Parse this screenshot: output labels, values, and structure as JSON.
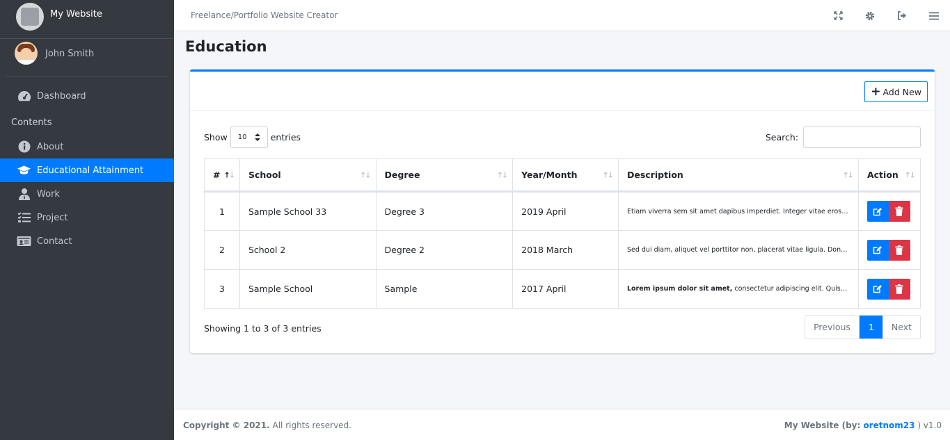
{
  "brand": {
    "name": "My Website"
  },
  "user": {
    "name": "John Smith"
  },
  "sidebar": {
    "dashboard": "Dashboard",
    "header": "Contents",
    "items": [
      {
        "label": "About",
        "icon": "info-circle-icon"
      },
      {
        "label": "Educational Attainment",
        "icon": "graduation-cap-icon",
        "active": true
      },
      {
        "label": "Work",
        "icon": "user-tie-icon"
      },
      {
        "label": "Project",
        "icon": "tasks-icon"
      },
      {
        "label": "Contact",
        "icon": "id-card-icon"
      }
    ]
  },
  "topbar": {
    "title": "Freelance/Portfolio Website Creator"
  },
  "page": {
    "title": "Education"
  },
  "card": {
    "add_label": "Add New"
  },
  "table_controls": {
    "show_label": "Show",
    "entries_label": "entries",
    "page_length": "10",
    "search_label": "Search:"
  },
  "table": {
    "headers": [
      "#",
      "School",
      "Degree",
      "Year/Month",
      "Description",
      "Action"
    ],
    "rows": [
      {
        "num": "1",
        "school": "Sample School 33",
        "degree": "Degree 3",
        "year": "2019 April",
        "desc_bold": "",
        "desc": "Etiam viverra sem sit amet dapibus imperdiet. Integer vitae eros ex..."
      },
      {
        "num": "2",
        "school": "School 2",
        "degree": "Degree 2",
        "year": "2018 March",
        "desc_bold": "",
        "desc": "Sed dui diam, aliquet vel porttitor non, placerat vitae ligula. Donec..."
      },
      {
        "num": "3",
        "school": "Sample School",
        "degree": "Sample",
        "year": "2017 April",
        "desc_bold": "Lorem ipsum dolor sit amet,",
        "desc": " consectetur adipiscing elit. Quisque..."
      }
    ]
  },
  "pagination": {
    "info": "Showing 1 to 3 of 3 entries",
    "previous": "Previous",
    "current": "1",
    "next": "Next"
  },
  "footer": {
    "copyright": "Copyright © 2021.",
    "rights": " All rights reserved.",
    "site": "My Website (by: ",
    "author": "oretnom23",
    "after": " ) v1.0"
  },
  "colors": {
    "accent": "#007bff",
    "danger": "#dc3545",
    "sidebar": "#343a40"
  }
}
